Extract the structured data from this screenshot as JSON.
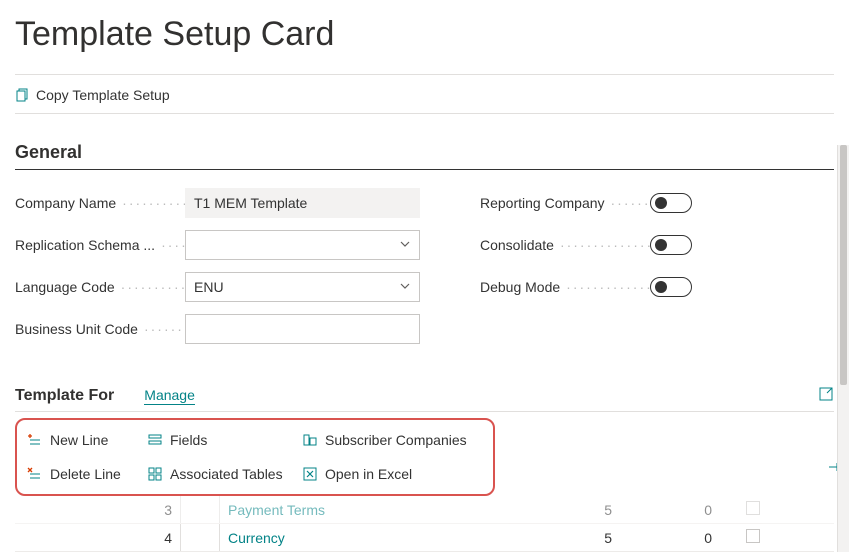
{
  "page_title": "Template Setup Card",
  "actions": {
    "copy_template": "Copy Template Setup"
  },
  "general": {
    "heading": "General",
    "company_name_label": "Company Name",
    "company_name_value": "T1 MEM Template",
    "replication_label": "Replication Schema ...",
    "replication_value": "",
    "language_label": "Language Code",
    "language_value": "ENU",
    "business_unit_label": "Business Unit Code",
    "business_unit_value": "",
    "reporting_label": "Reporting Company",
    "consolidate_label": "Consolidate",
    "debug_label": "Debug Mode"
  },
  "template_for": {
    "title": "Template For",
    "manage": "Manage",
    "menu": {
      "new_line": "New Line",
      "fields": "Fields",
      "subscriber": "Subscriber Companies",
      "delete_line": "Delete Line",
      "assoc_tables": "Associated Tables",
      "open_excel": "Open in Excel"
    }
  },
  "table": {
    "rows": [
      {
        "num": "3",
        "name": "Payment Terms",
        "v1": "5",
        "v2": "0"
      },
      {
        "num": "4",
        "name": "Currency",
        "v1": "5",
        "v2": "0"
      }
    ]
  }
}
